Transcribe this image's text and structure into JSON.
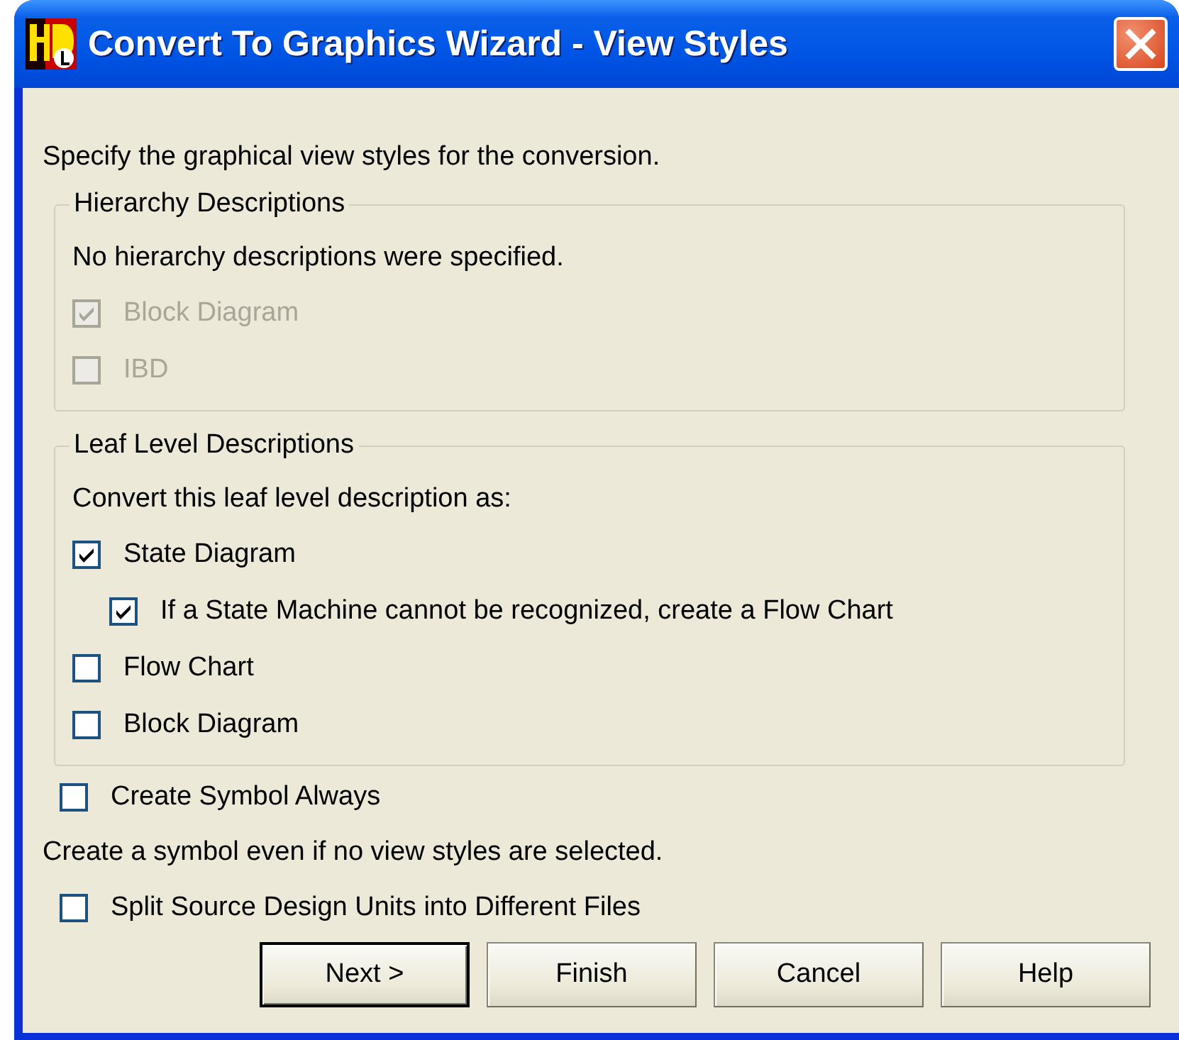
{
  "window": {
    "title": "Convert To Graphics Wizard - View Styles"
  },
  "intro": "Specify the graphical view styles for the conversion.",
  "hierarchy": {
    "title": "Hierarchy Descriptions",
    "note": "No hierarchy descriptions were specified.",
    "options": [
      {
        "label": "Block Diagram",
        "checked": true,
        "disabled": true
      },
      {
        "label": "IBD",
        "checked": false,
        "disabled": true
      }
    ]
  },
  "leaf": {
    "title": "Leaf Level Descriptions",
    "note": "Convert this leaf level description as:",
    "options": [
      {
        "label": "State Diagram",
        "checked": true,
        "disabled": false,
        "children": [
          {
            "label": "If a State Machine cannot be recognized, create a Flow Chart",
            "checked": true,
            "disabled": false
          }
        ]
      },
      {
        "label": "Flow Chart",
        "checked": false,
        "disabled": false
      },
      {
        "label": "Block Diagram",
        "checked": false,
        "disabled": false
      }
    ]
  },
  "create_symbol": {
    "label": "Create Symbol Always",
    "checked": false,
    "disabled": false,
    "note": "Create a symbol even if no view styles are selected."
  },
  "split": {
    "label": "Split Source Design Units into Different Files",
    "checked": false,
    "disabled": false
  },
  "buttons": [
    {
      "label": "Next >",
      "default": true
    },
    {
      "label": "Finish",
      "default": false
    },
    {
      "label": "Cancel",
      "default": false
    },
    {
      "label": "Help",
      "default": false
    }
  ]
}
